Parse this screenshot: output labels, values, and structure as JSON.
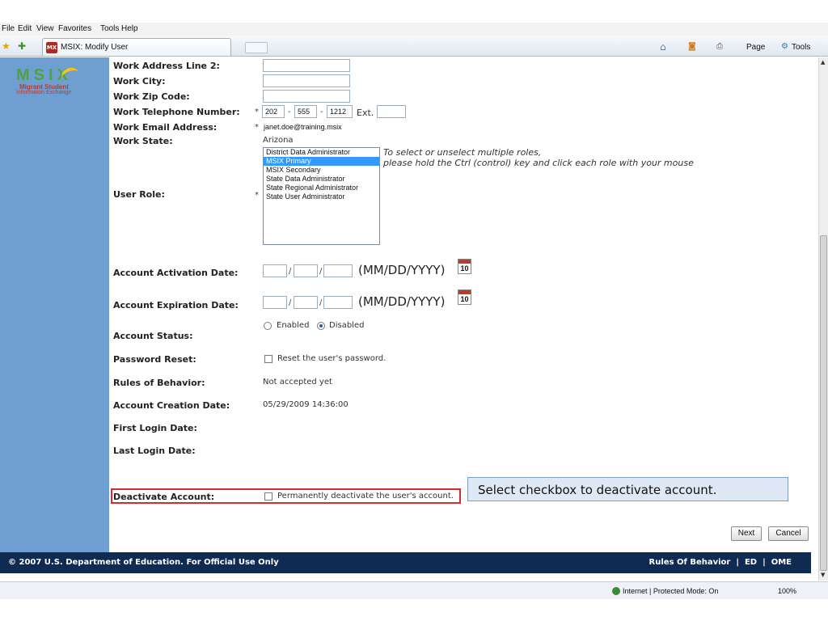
{
  "browser": {
    "menu": [
      "File",
      "Edit",
      "View",
      "Favorites",
      "Tools",
      "Help"
    ],
    "tab_title": "MSIX: Modify User",
    "commands": {
      "page": "Page",
      "tools": "Tools"
    },
    "status": {
      "zone": "Internet | Protected Mode: On",
      "zoom": "100%"
    }
  },
  "logo": {
    "letters": "MSIX",
    "line1": "Migrant Student",
    "line2": "Information Exchange"
  },
  "form": {
    "work_address_line2": {
      "label": "Work Address Line 2:",
      "value": ""
    },
    "work_city": {
      "label": "Work City:",
      "value": ""
    },
    "work_zip": {
      "label": "Work Zip Code:",
      "value": ""
    },
    "work_phone": {
      "label": "Work Telephone Number:",
      "area": "202",
      "prefix": "555",
      "line": "1212",
      "ext_label": "Ext.",
      "ext": ""
    },
    "work_email": {
      "label": "Work Email Address:",
      "value": "janet.doe@training.msix"
    },
    "work_state": {
      "label": "Work State:",
      "value": "Arizona"
    },
    "user_role": {
      "label": "User Role:",
      "options": [
        "District Data Administrator",
        "MSIX Primary",
        "MSIX Secondary",
        "State Data Administrator",
        "State Regional Administrator",
        "State User Administrator"
      ],
      "selected": "MSIX Primary",
      "hint_line1": "To select or unselect multiple roles,",
      "hint_line2": "please hold the Ctrl (control) key and click each role with your mouse"
    },
    "activation": {
      "label": "Account Activation Date:",
      "format": "(MM/DD/YYYY)",
      "calendar_num": "10"
    },
    "expiration": {
      "label": "Account Expiration Date:",
      "format": "(MM/DD/YYYY)",
      "calendar_num": "10"
    },
    "status": {
      "label": "Account Status:",
      "enabled": "Enabled",
      "disabled": "Disabled",
      "selected": "Disabled"
    },
    "password_reset": {
      "label": "Password Reset:",
      "text": "Reset the user's password."
    },
    "rules": {
      "label": "Rules of Behavior:",
      "value": "Not accepted yet"
    },
    "creation_date": {
      "label": "Account Creation Date:",
      "value": "05/29/2009 14:36:00"
    },
    "first_login": {
      "label": "First Login Date:",
      "value": ""
    },
    "last_login": {
      "label": "Last Login Date:",
      "value": ""
    },
    "deactivate": {
      "label": "Deactivate Account:",
      "text": "Permanently deactivate the user's account."
    }
  },
  "callout": "Select checkbox to deactivate account.",
  "buttons": {
    "next": "Next",
    "cancel": "Cancel"
  },
  "footer": {
    "copyright": "© 2007 U.S. Department of Education. For Official Use Only",
    "links": [
      "Rules Of Behavior",
      "ED",
      "OME"
    ]
  }
}
